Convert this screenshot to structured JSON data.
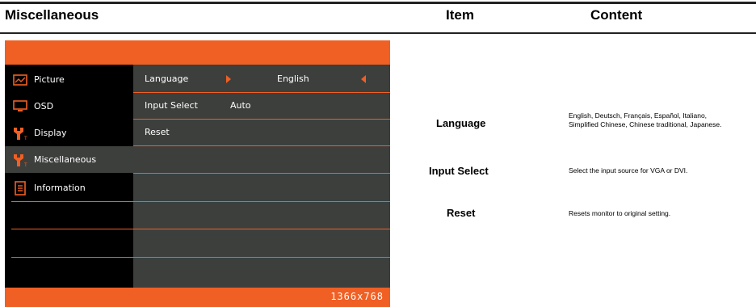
{
  "header": {
    "section_title": "Miscellaneous",
    "item_col": "Item",
    "content_col": "Content"
  },
  "colors": {
    "accent": "#f05f24",
    "menu_bg": "#000000",
    "submenu_bg": "#3d3f3d",
    "text": "#ffffff"
  },
  "osd": {
    "menu": [
      {
        "label": "Picture",
        "icon": "picture-icon",
        "active": false
      },
      {
        "label": "OSD",
        "icon": "monitor-icon",
        "active": false
      },
      {
        "label": "Display",
        "icon": "wrench-icon",
        "active": false
      },
      {
        "label": "Miscellaneous",
        "icon": "wrench-icon",
        "active": true
      },
      {
        "label": "Information",
        "icon": "document-icon",
        "active": false
      }
    ],
    "submenu": {
      "language_label": "Language",
      "language_value": "English",
      "input_select_label": "Input Select",
      "input_select_value": "Auto",
      "reset_label": "Reset"
    },
    "resolution": "1366x768"
  },
  "table": {
    "rows": [
      {
        "item": "Language",
        "content": "English, Deutsch, Français, Español, Italiano,\nSimplified Chinese, Chinese traditional, Japanese."
      },
      {
        "item": "Input Select",
        "content": "Select the input source for VGA or DVI."
      },
      {
        "item": "Reset",
        "content": "Resets monitor to original setting."
      }
    ]
  }
}
